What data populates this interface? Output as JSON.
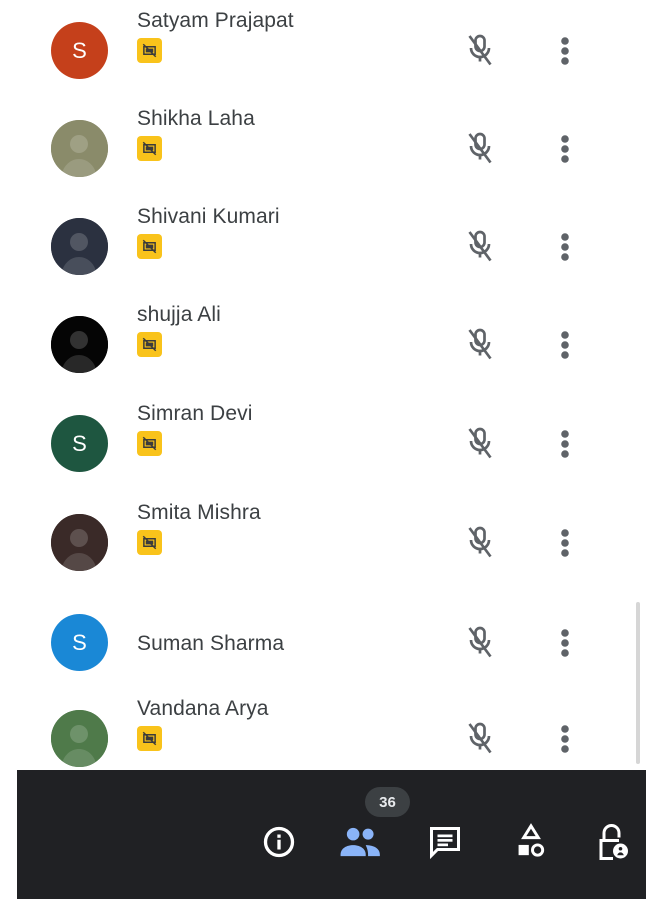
{
  "participants": [
    {
      "name": "Satyam Prajapat",
      "initial": "S",
      "avatar_color": "#c5401b",
      "avatar_type": "initial",
      "presenting_badge": true
    },
    {
      "name": "Shikha Laha",
      "initial": "",
      "avatar_color": "#8a8b6a",
      "avatar_type": "photo",
      "presenting_badge": true
    },
    {
      "name": "Shivani Kumari",
      "initial": "",
      "avatar_color": "#2b3140",
      "avatar_type": "photo",
      "presenting_badge": true
    },
    {
      "name": "shujja Ali",
      "initial": "",
      "avatar_color": "#050505",
      "avatar_type": "photo",
      "presenting_badge": true
    },
    {
      "name": "Simran Devi",
      "initial": "S",
      "avatar_color": "#1e5640",
      "avatar_type": "initial",
      "presenting_badge": true
    },
    {
      "name": "Smita Mishra",
      "initial": "",
      "avatar_color": "#3a2a28",
      "avatar_type": "photo",
      "presenting_badge": true
    },
    {
      "name": "Suman Sharma",
      "initial": "S",
      "avatar_color": "#1a88d6",
      "avatar_type": "initial",
      "presenting_badge": false
    },
    {
      "name": "Vandana Arya",
      "initial": "",
      "avatar_color": "#4f7a4a",
      "avatar_type": "photo",
      "presenting_badge": true
    }
  ],
  "row_icons": {
    "mic": "mic-off-icon",
    "menu": "more-vert-icon"
  },
  "bottom_bar": {
    "people_count": "36",
    "icons": [
      "info-icon",
      "people-icon",
      "chat-icon",
      "activities-icon",
      "host-controls-icon"
    ],
    "active_color": "#8ab4f8",
    "icon_color": "#ffffff"
  },
  "colors": {
    "badge": "#f9c31b",
    "text": "#3c4043",
    "bar": "#202124"
  }
}
